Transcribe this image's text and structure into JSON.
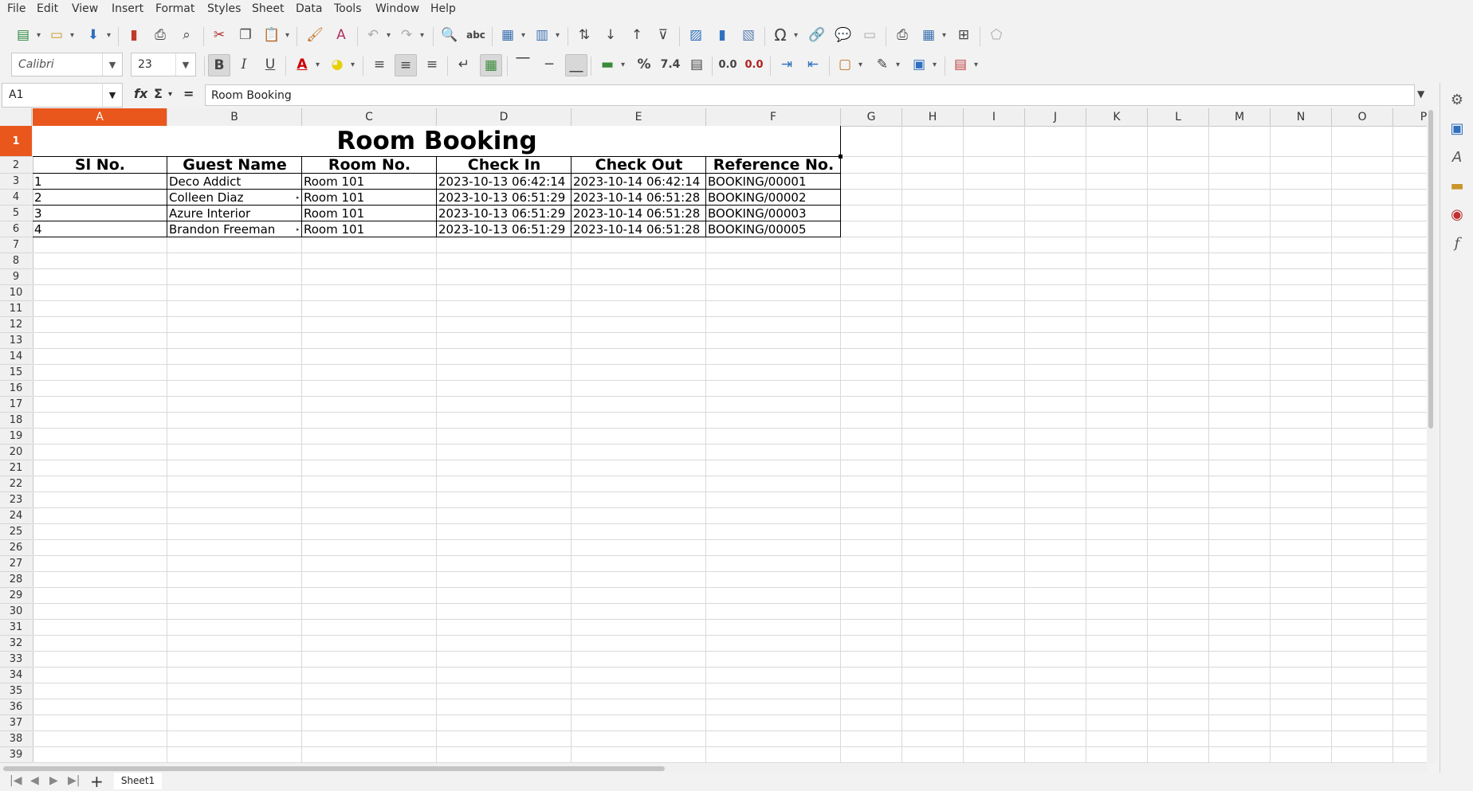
{
  "menu": [
    "File",
    "Edit",
    "View",
    "Insert",
    "Format",
    "Styles",
    "Sheet",
    "Data",
    "Tools",
    "Window",
    "Help"
  ],
  "font": {
    "name": "Calibri",
    "size": "23"
  },
  "number_format": {
    "percent": "%",
    "decimal": "7.4",
    "add_decimal": "0.0",
    "del_decimal": "0.0"
  },
  "name_box": "A1",
  "formula_content": "Room Booking",
  "columns": [
    "A",
    "B",
    "C",
    "D",
    "E",
    "F",
    "G",
    "H",
    "I",
    "J",
    "K",
    "L",
    "M",
    "N",
    "O",
    "P"
  ],
  "rows": [
    "1",
    "2",
    "3",
    "4",
    "5",
    "6",
    "7",
    "8",
    "9",
    "10",
    "11",
    "12",
    "13",
    "14",
    "15",
    "16",
    "17",
    "18",
    "19",
    "20",
    "21",
    "22",
    "23",
    "24",
    "25",
    "26",
    "27",
    "28",
    "29",
    "30",
    "31",
    "32",
    "33",
    "34",
    "35",
    "36",
    "37",
    "38",
    "39"
  ],
  "sheet": {
    "title": "Room Booking",
    "headers": [
      "Sl No.",
      "Guest Name",
      "Room No.",
      "Check In",
      "Check Out",
      "Reference No."
    ],
    "rows": [
      [
        "1",
        "Deco Addict",
        "Room 101",
        "2023-10-13 06:42:14",
        "2023-10-14 06:42:14",
        "BOOKING/00001"
      ],
      [
        "2",
        "Colleen Diaz",
        "Room 101",
        "2023-10-13 06:51:29",
        "2023-10-14 06:51:28",
        "BOOKING/00002"
      ],
      [
        "3",
        "Azure Interior",
        "Room 101",
        "2023-10-13 06:51:29",
        "2023-10-14 06:51:28",
        "BOOKING/00003"
      ],
      [
        "4",
        "Brandon Freeman",
        "Room 101",
        "2023-10-13 06:51:29",
        "2023-10-14 06:51:28",
        "BOOKING/00005"
      ]
    ]
  },
  "tabs": {
    "sheet1": "Sheet1"
  },
  "selection_color": "#e9571d"
}
